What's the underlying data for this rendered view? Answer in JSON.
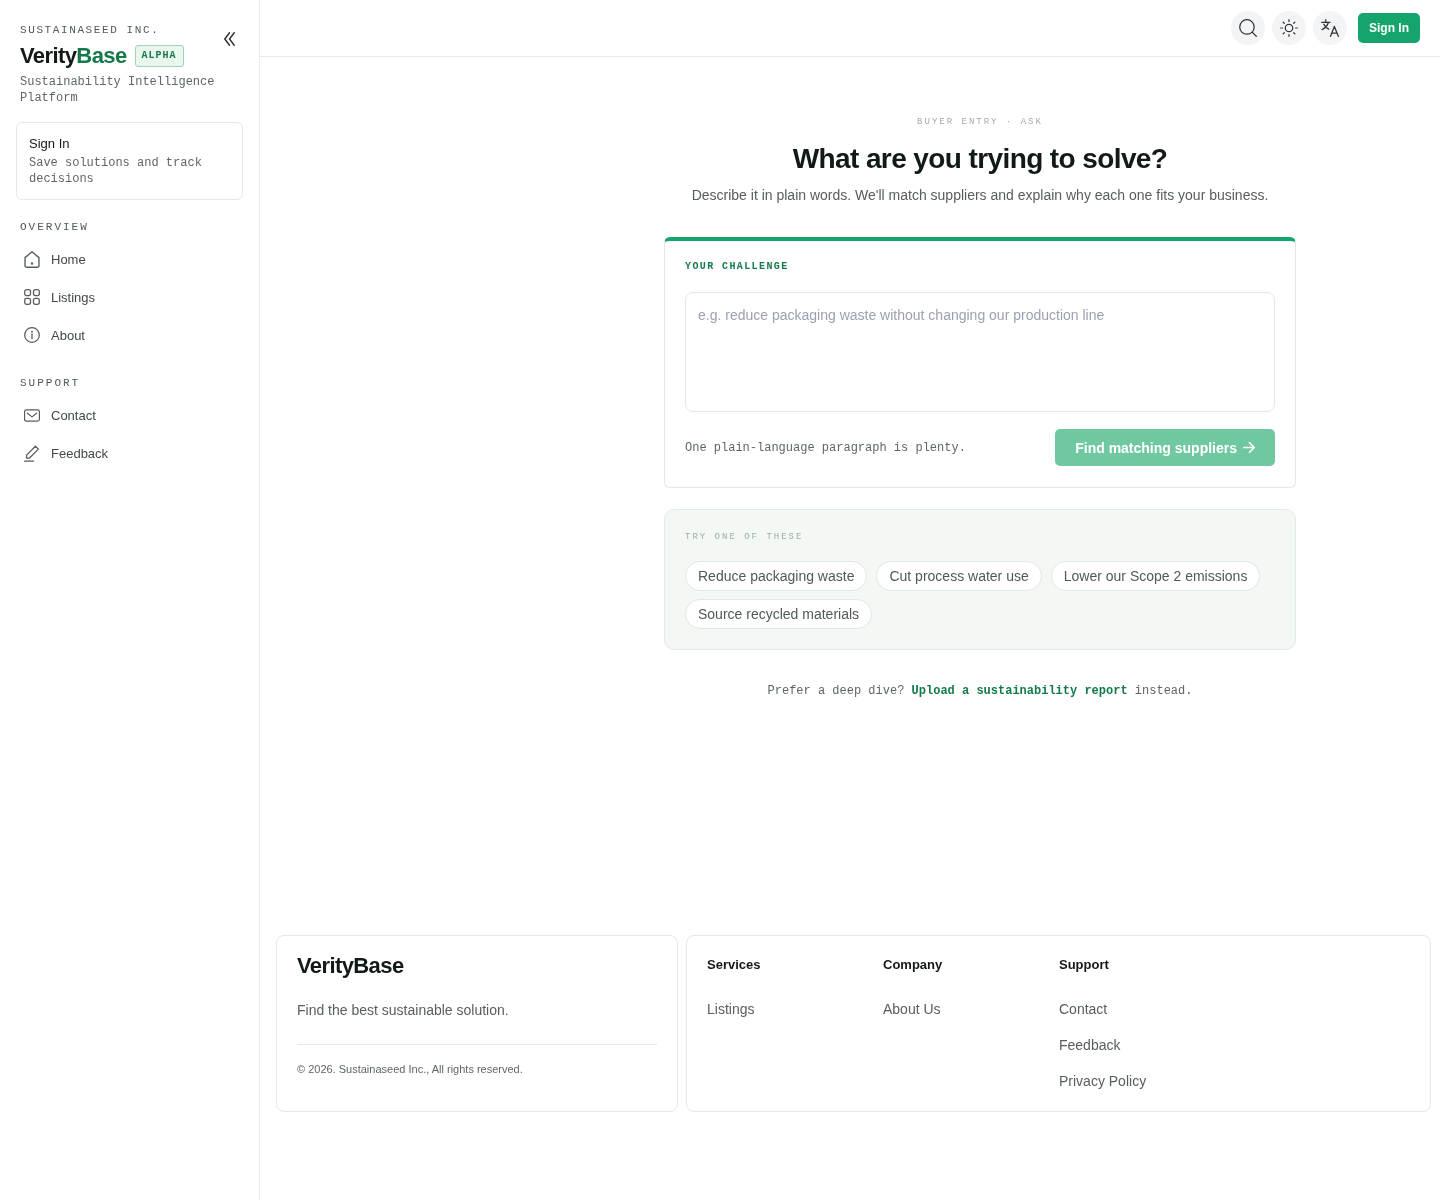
{
  "sidebar": {
    "company": "SUSTAINASEED INC.",
    "brand": {
      "parts": [
        "Verity",
        "Base"
      ],
      "badge": "ALPHA"
    },
    "tagline": "Sustainability Intelligence Platform",
    "account_card": {
      "title": "Sign In",
      "description": "Save solutions and track decisions"
    },
    "sections": [
      {
        "heading": "OVERVIEW",
        "items": [
          {
            "label": "Home",
            "selected": false
          },
          {
            "label": "Listings",
            "selected": false
          },
          {
            "label": "About",
            "selected": false
          }
        ]
      },
      {
        "heading": "SUPPORT",
        "items": [
          {
            "label": "Contact",
            "selected": false
          },
          {
            "label": "Feedback",
            "selected": false
          }
        ]
      }
    ]
  },
  "header": {
    "sign_in": "Sign In"
  },
  "main": {
    "eyebrow": "BUYER ENTRY · ASK",
    "title": "What are you trying to solve?",
    "subtitle": "Describe it in plain words. We'll match suppliers and explain why each one fits your business.",
    "challenge": {
      "label": "YOUR CHALLENGE",
      "placeholder": "e.g. reduce packaging waste without changing our production line",
      "hint": "One plain-language paragraph is plenty.",
      "submit": {
        "label": "Find matching suppliers",
        "disabled": true
      }
    },
    "suggestions": {
      "heading": "TRY ONE OF THESE",
      "chips": [
        "Reduce packaging waste",
        "Cut process water use",
        "Lower our Scope 2 emissions",
        "Source recycled materials"
      ]
    },
    "upload_prompt": {
      "before": "Prefer a deep dive?",
      "link": "Upload a sustainability report",
      "after": "instead."
    }
  },
  "footer": {
    "brand": "VerityBase",
    "tagline": "Find the best sustainable solution.",
    "copyright": "© 2026. Sustainaseed Inc., All rights reserved.",
    "columns": [
      {
        "heading": "Services",
        "links": [
          "Listings"
        ]
      },
      {
        "heading": "Company",
        "links": [
          "About Us"
        ]
      },
      {
        "heading": "Support",
        "links": [
          "Contact",
          "Feedback",
          "Privacy Policy"
        ]
      }
    ]
  }
}
